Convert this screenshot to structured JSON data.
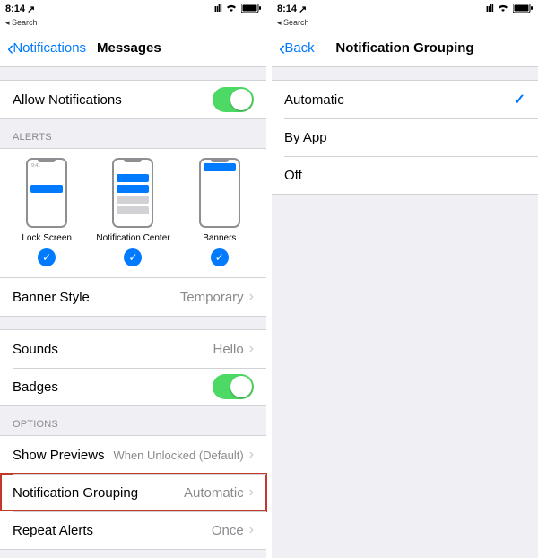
{
  "left": {
    "status": {
      "time": "8:14",
      "backApp": "◂ Search"
    },
    "nav": {
      "back": "Notifications",
      "title": "Messages"
    },
    "allowNotifications": {
      "label": "Allow Notifications"
    },
    "alertsHeader": "ALERTS",
    "alertOptions": {
      "lockScreen": "Lock Screen",
      "notificationCenter": "Notification Center",
      "banners": "Banners"
    },
    "bannerStyle": {
      "label": "Banner Style",
      "value": "Temporary"
    },
    "sounds": {
      "label": "Sounds",
      "value": "Hello"
    },
    "badges": {
      "label": "Badges"
    },
    "optionsHeader": "OPTIONS",
    "showPreviews": {
      "label": "Show Previews",
      "value": "When Unlocked (Default)"
    },
    "notificationGrouping": {
      "label": "Notification Grouping",
      "value": "Automatic"
    },
    "repeatAlerts": {
      "label": "Repeat Alerts",
      "value": "Once"
    }
  },
  "right": {
    "status": {
      "time": "8:14",
      "backApp": "◂ Search"
    },
    "nav": {
      "back": "Back",
      "title": "Notification Grouping"
    },
    "options": {
      "automatic": "Automatic",
      "byApp": "By App",
      "off": "Off"
    }
  }
}
